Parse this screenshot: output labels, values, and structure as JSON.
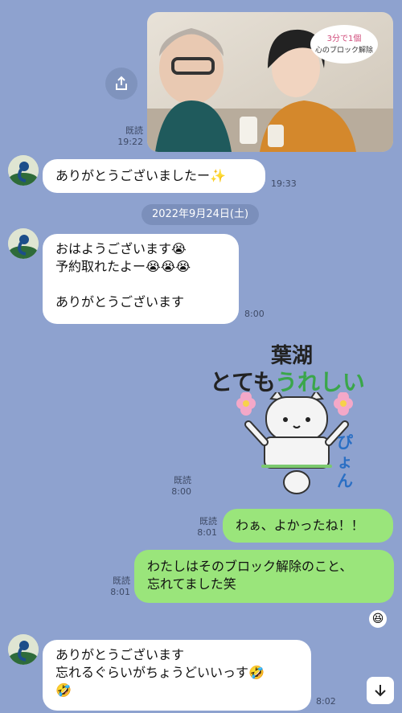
{
  "messages": {
    "photo_read_label": "既読",
    "photo_time": "19:22",
    "photo_overlay_text": "3分で1個\n心のブロック解除",
    "msg1_text": "ありがとうございましたー",
    "msg1_emoji": "✨",
    "msg1_time": "19:33",
    "date_separator": "2022年9月24日(土)",
    "msg2_line1": "おはようございます",
    "msg2_line2": "予約取れたよー",
    "msg2_line3": "ありがとうございます",
    "msg2_emoji": "😭",
    "msg2_time": "8:00",
    "sticker_line1": "葉湖",
    "sticker_line2a": "とても",
    "sticker_line2b": "うれしい",
    "sticker_side": "ぴょん",
    "sticker_read": "既読",
    "sticker_time": "8:00",
    "msg3_read": "既読",
    "msg3_time": "8:01",
    "msg3_text": "わぁ、よかったね！！",
    "msg4_read": "既読",
    "msg4_time": "8:01",
    "msg4_line1": "わたしはそのブロック解除のこと、",
    "msg4_line2": "忘れてました笑",
    "msg5_line1": "ありがとうございます",
    "msg5_line2": "忘れるぐらいがちょうどいいっす",
    "msg5_emoji": "🤣",
    "msg5_time": "8:02",
    "reaction_emoji": "😆"
  },
  "icons": {
    "share": "share-icon",
    "scroll": "arrow-down-icon",
    "avatar": "peacock-avatar-icon"
  },
  "colors": {
    "background": "#8ea2cf",
    "outgoing_bubble": "#9ae57b",
    "incoming_bubble": "#ffffff",
    "date_pill": "#7b8fbb"
  }
}
